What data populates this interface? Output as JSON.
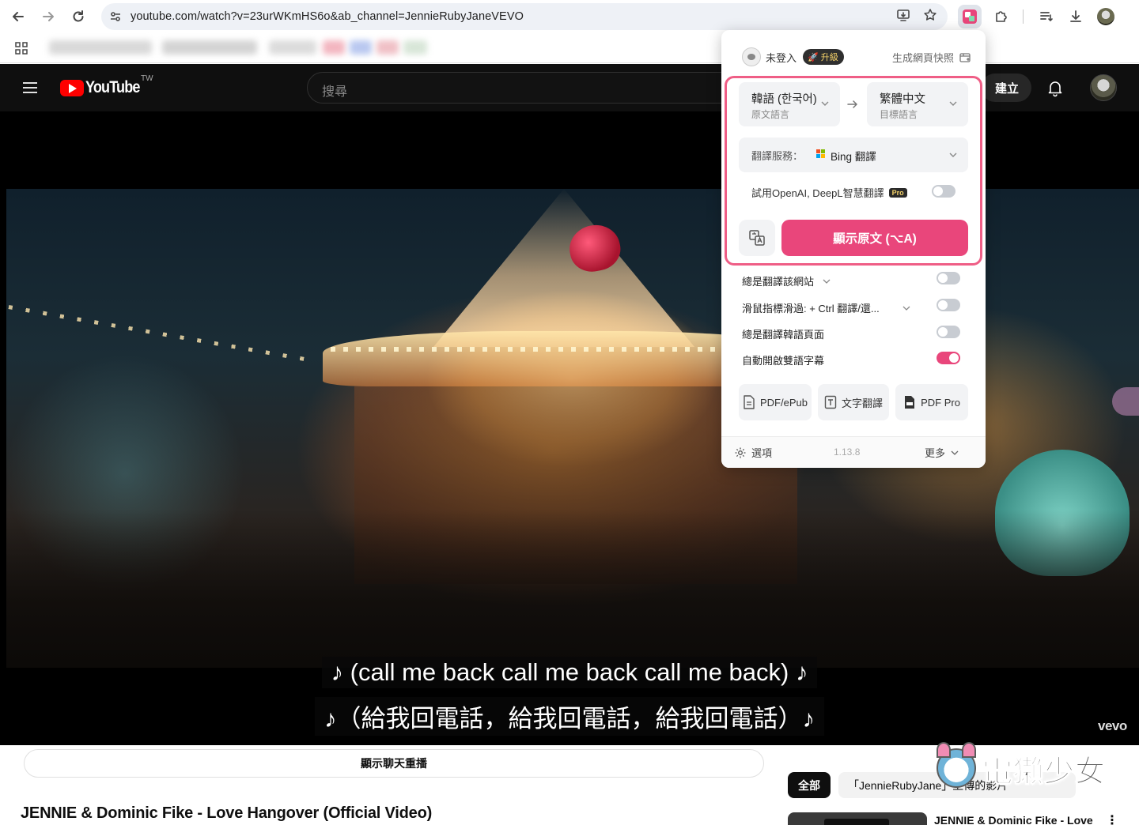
{
  "browser": {
    "url": "youtube.com/watch?v=23urWKmHS6o&ab_channel=JennieRubyJaneVEVO"
  },
  "youtube": {
    "logo_text": "YouTube",
    "region": "TW",
    "search_placeholder": "搜尋",
    "create_label": "建立",
    "subtitle_original": "♪ (call me back call me back call me back) ♪",
    "subtitle_translated": "♪（給我回電話，給我回電話，給我回電話）♪",
    "channel_watermark": "vevo",
    "chat_replay_label": "顯示聊天重播",
    "video_title": "JENNIE & Dominic Fike - Love Hangover (Official Video)",
    "chips": [
      "全部",
      "「JennieRubyJane」上傳的影片"
    ],
    "rec_title": "JENNIE & Dominic Fike - Love",
    "rec_more": "⋮"
  },
  "watermark": {
    "text": "電獺少女"
  },
  "popup": {
    "login_text": "未登入",
    "upgrade_label": "升級",
    "snapshot_label": "生成網頁快照",
    "source_lang": {
      "name": "韓語 (한국어)",
      "role": "原文語言"
    },
    "target_lang": {
      "name": "繁體中文",
      "role": "目標語言"
    },
    "service_label": "翻譯服務：",
    "service_value": "Bing 翻譯",
    "pro_try_label": "試用OpenAI, DeepL智慧翻譯",
    "pro_badge": "Pro",
    "show_original_label": "顯示原文 (⌥A)",
    "options": [
      {
        "label": "總是翻譯該網站",
        "has_dropdown": true,
        "on": false
      },
      {
        "label": "滑鼠指標滑過: + Ctrl 翻譯/還...",
        "has_dropdown": true,
        "on": false
      },
      {
        "label": "總是翻譯韓語頁面",
        "has_dropdown": false,
        "on": false
      },
      {
        "label": "自動開啟雙語字幕",
        "has_dropdown": false,
        "on": true
      }
    ],
    "tools": [
      "PDF/ePub",
      "文字翻譯",
      "PDF Pro"
    ],
    "footer": {
      "options_label": "選項",
      "version": "1.13.8",
      "more_label": "更多"
    }
  },
  "colors": {
    "accent": "#e9467b",
    "highlight_border": "#ef5e86",
    "yt_red": "#ff0000"
  }
}
